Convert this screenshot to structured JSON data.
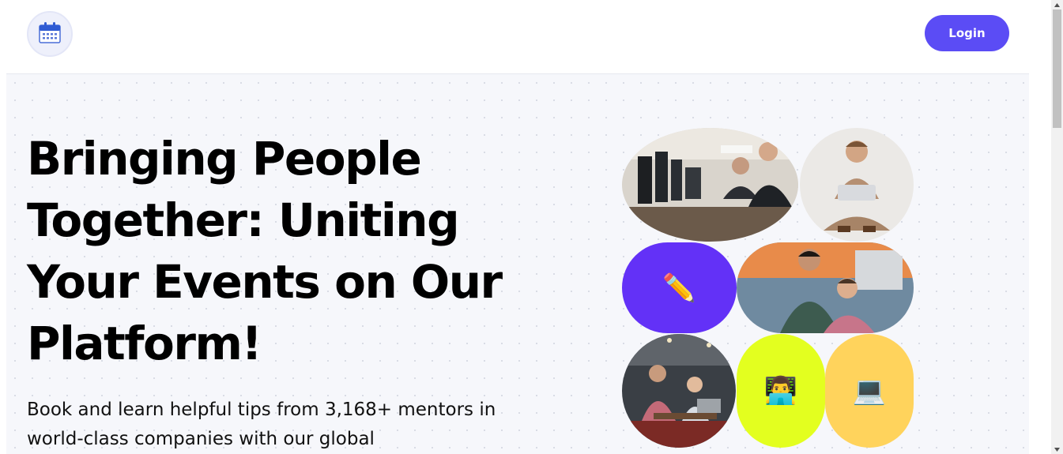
{
  "header": {
    "logo_icon": "calendar-icon",
    "login_label": "Login",
    "accent_color": "#5b4cf5"
  },
  "hero": {
    "headline": "Bringing People Together: Uniting Your Events on Our Platform!",
    "subtext": "Book and learn helpful tips from 3,168+ mentors in world-class companies with our global",
    "background_color": "#f6f7fb"
  },
  "gallery": {
    "tiles": [
      {
        "kind": "photo",
        "subject": "two men working at computer monitors"
      },
      {
        "kind": "photo",
        "subject": "smiling man sitting cross-legged with laptop"
      },
      {
        "kind": "emoji",
        "emoji": "✏️",
        "icon": "pencil-icon",
        "color": "#6331f7"
      },
      {
        "kind": "photo",
        "subject": "two young men looking at a screen"
      },
      {
        "kind": "photo",
        "subject": "man and woman talking at a cafe table"
      },
      {
        "kind": "emoji",
        "emoji": "👨‍💻",
        "icon": "technologist-icon",
        "color": "#e3ff1f"
      },
      {
        "kind": "emoji",
        "emoji": "💻",
        "icon": "laptop-icon",
        "color": "#ffd35c"
      }
    ]
  }
}
